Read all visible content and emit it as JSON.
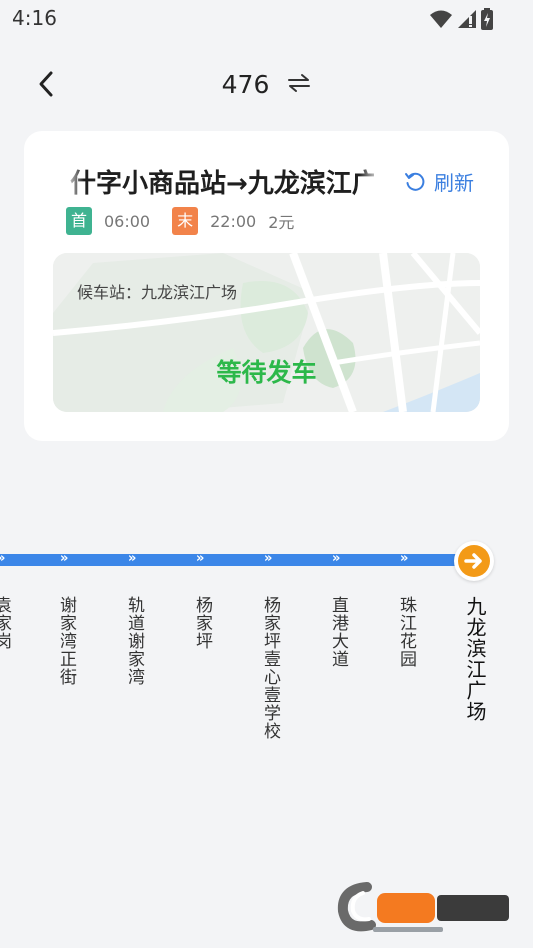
{
  "status_bar": {
    "time": "4:16"
  },
  "header": {
    "route_number": "476"
  },
  "card": {
    "direction": "什字小商品站→九龙滨江广场",
    "refresh_label": "刷新",
    "first_tag": "首",
    "first_time": "06:00",
    "last_tag": "末",
    "last_time": "22:00",
    "price": "2元",
    "waiting_label": "候车站：九龙滨江广场",
    "waiting_status": "等待发车"
  },
  "stops": [
    "袁家岗",
    "谢家湾正街",
    "轨道谢家湾",
    "杨家坪",
    "杨家坪壹心壹学校",
    "直港大道",
    "珠江花园",
    "九龙滨江广场"
  ],
  "colors": {
    "accent_blue": "#3b86e8",
    "first_green": "#3fb391",
    "last_orange": "#f2834a",
    "status_green": "#2cb84a",
    "current_orange": "#f39a17"
  },
  "icons": [
    "back-arrow-icon",
    "swap-icon",
    "refresh-icon",
    "arrow-right-circle-icon",
    "wifi-icon",
    "signal-icon",
    "battery-icon"
  ]
}
